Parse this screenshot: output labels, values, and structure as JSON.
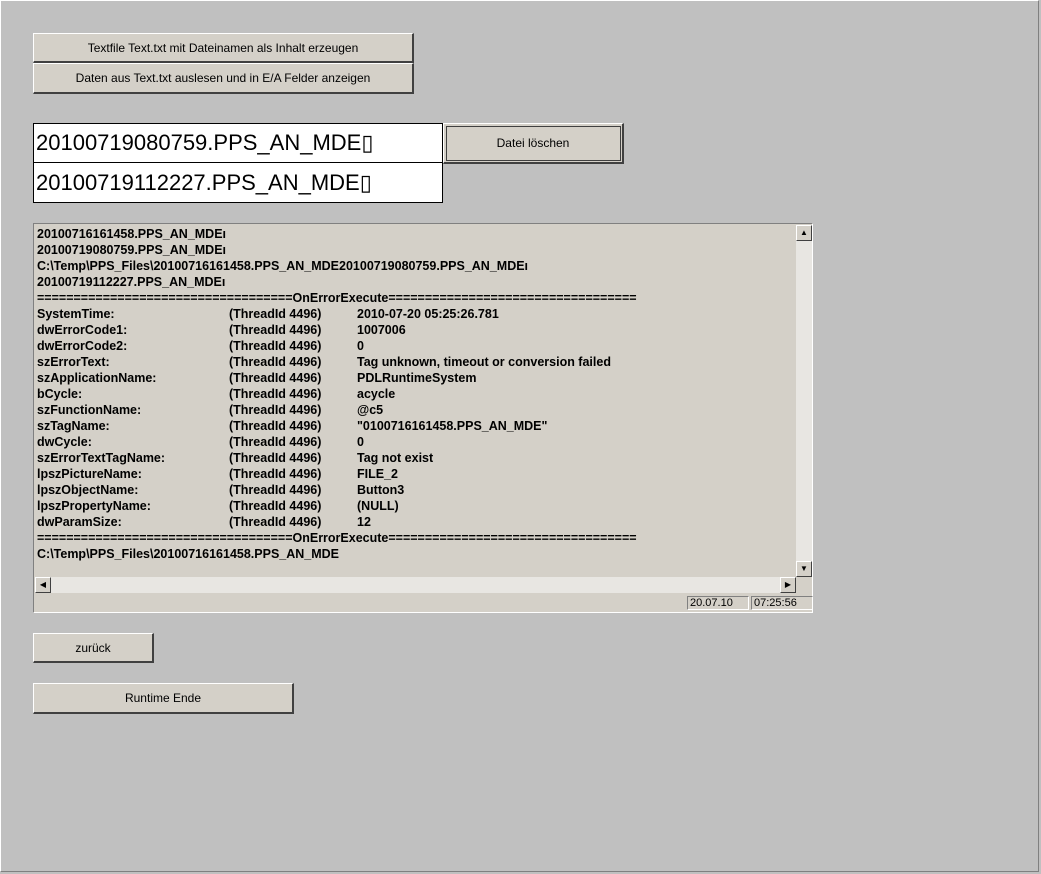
{
  "buttons": {
    "create_textfile": "Textfile Text.txt mit Dateinamen als Inhalt erzeugen",
    "read_textfile": "Daten aus Text.txt auslesen und in E/A Felder anzeigen",
    "delete_file": "Datei löschen",
    "back": "zurück",
    "runtime_end": "Runtime Ende"
  },
  "io_fields": {
    "field1": "20100719080759.PPS_AN_MDE▯",
    "field2": "20100719112227.PPS_AN_MDE▯"
  },
  "log": {
    "lines": [
      "20100716161458.PPS_AN_MDEı",
      "20100719080759.PPS_AN_MDEı",
      "C:\\Temp\\PPS_Files\\20100716161458.PPS_AN_MDE20100719080759.PPS_AN_MDEı",
      "20100719112227.PPS_AN_MDEı",
      "===================================OnErrorExecute=================================="
    ],
    "entries": [
      {
        "key": "SystemTime:",
        "thread": "(ThreadId 4496)",
        "value": "2010-07-20 05:25:26.781"
      },
      {
        "key": "dwErrorCode1:",
        "thread": "(ThreadId 4496)",
        "value": "1007006"
      },
      {
        "key": "dwErrorCode2:",
        "thread": "(ThreadId 4496)",
        "value": "0"
      },
      {
        "key": "szErrorText:",
        "thread": "(ThreadId 4496)",
        "value": "Tag unknown, timeout or conversion failed"
      },
      {
        "key": "szApplicationName:",
        "thread": "(ThreadId 4496)",
        "value": "PDLRuntimeSystem"
      },
      {
        "key": "bCycle:",
        "thread": "(ThreadId 4496)",
        "value": "acycle"
      },
      {
        "key": "szFunctionName:",
        "thread": "(ThreadId 4496)",
        "value": "@c5"
      },
      {
        "key": "szTagName:",
        "thread": "(ThreadId 4496)",
        "value": "\"0100716161458.PPS_AN_MDE\""
      },
      {
        "key": "dwCycle:",
        "thread": "(ThreadId 4496)",
        "value": "0"
      },
      {
        "key": "szErrorTextTagName:",
        "thread": "(ThreadId 4496)",
        "value": "Tag not exist"
      },
      {
        "key": "lpszPictureName:",
        "thread": "(ThreadId 4496)",
        "value": "FILE_2"
      },
      {
        "key": "lpszObjectName:",
        "thread": "(ThreadId 4496)",
        "value": "Button3"
      },
      {
        "key": "lpszPropertyName:",
        "thread": "(ThreadId 4496)",
        "value": "(NULL)"
      },
      {
        "key": "dwParamSize:",
        "thread": "(ThreadId 4496)",
        "value": "12"
      }
    ],
    "footer_lines": [
      "===================================OnErrorExecute==================================",
      "C:\\Temp\\PPS_Files\\20100716161458.PPS_AN_MDE"
    ]
  },
  "status": {
    "date": "20.07.10",
    "time": "07:25:56"
  },
  "icons": {
    "up": "scroll-up-arrow",
    "down": "scroll-down-arrow",
    "left": "scroll-left-arrow",
    "right": "scroll-right-arrow"
  }
}
